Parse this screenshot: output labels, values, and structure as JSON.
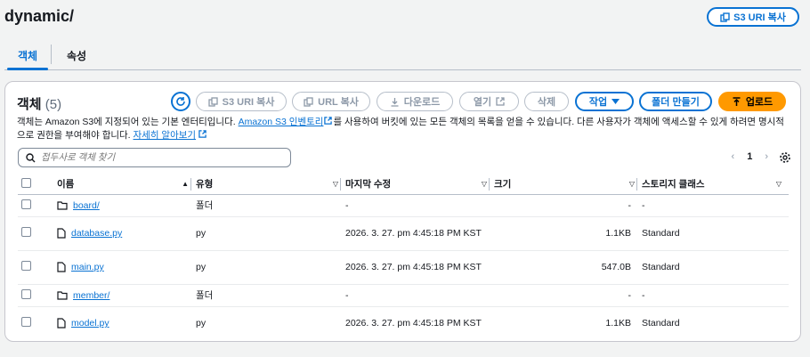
{
  "header": {
    "bucket_path": "dynamic/",
    "copy_uri_label": "S3 URI 복사"
  },
  "tabs": [
    {
      "label": "객체",
      "active": true
    },
    {
      "label": "속성",
      "active": false
    }
  ],
  "panel": {
    "title": "객체",
    "count": "(5)",
    "buttons": {
      "copy_s3_uri": "S3 URI 복사",
      "copy_url": "URL 복사",
      "download": "다운로드",
      "open": "열기",
      "delete": "삭제",
      "actions": "작업",
      "create_folder": "폴더 만들기",
      "upload": "업로드"
    },
    "description_prefix": "객체는 Amazon S3에 지정되어 있는 기본 엔터티입니다.",
    "description_link1": "Amazon S3 인벤토리",
    "description_middle": "를 사용하여 버킷에 있는 모든 객체의 목록을 얻을 수 있습니다. 다른 사용자가 객체에 액세스할 수 있게 하려면 명시적으로 권한을 부여해야 합니다.",
    "description_link2": "자세히 알아보기",
    "search_placeholder": "접두사로 객체 찾기",
    "page_number": "1"
  },
  "table": {
    "columns": [
      "이름",
      "유형",
      "마지막 수정",
      "크기",
      "스토리지 클래스"
    ],
    "rows": [
      {
        "name": "board/",
        "type": "폴더",
        "modified": "-",
        "size": "-",
        "storage": "-",
        "kind": "folder"
      },
      {
        "name": "database.py",
        "type": "py",
        "modified": "2026. 3. 27. pm 4:45:18 PM KST",
        "size": "1.1KB",
        "storage": "Standard",
        "kind": "file"
      },
      {
        "name": "main.py",
        "type": "py",
        "modified": "2026. 3. 27. pm 4:45:18 PM KST",
        "size": "547.0B",
        "storage": "Standard",
        "kind": "file"
      },
      {
        "name": "member/",
        "type": "폴더",
        "modified": "-",
        "size": "-",
        "storage": "-",
        "kind": "folder"
      },
      {
        "name": "model.py",
        "type": "py",
        "modified": "2026. 3. 27. pm 4:45:18 PM KST",
        "size": "1.1KB",
        "storage": "Standard",
        "kind": "file"
      }
    ]
  },
  "colors": {
    "accent": "#0972d3",
    "primary": "#ff9900",
    "background": "#f2f3f3"
  }
}
